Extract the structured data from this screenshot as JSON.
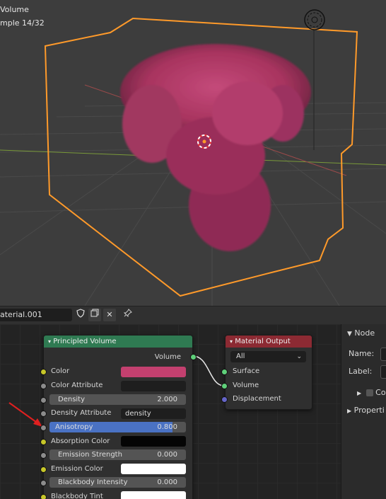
{
  "viewport": {
    "overlay_line1": " Volume",
    "overlay_line2": "mple 14/32"
  },
  "node_header": {
    "material_name": "aterial.001",
    "shield_icon": "shield-icon",
    "copy_icon": "copy-icon",
    "close_icon": "close-icon",
    "pin_icon": "pin-icon"
  },
  "principled_volume": {
    "title": "Principled Volume",
    "output_label": "Volume",
    "color_label": "Color",
    "color_value": "#c3406f",
    "color_attribute_label": "Color Attribute",
    "density_label": "Density",
    "density_value": "2.000",
    "density_attribute_label": "Density Attribute",
    "density_attribute_value": "density",
    "anisotropy_label": "Anisotropy",
    "anisotropy_value": "0.800",
    "anisotropy_fill": 0.9,
    "absorption_label": "Absorption Color",
    "emission_strength_label": "Emission Strength",
    "emission_strength_value": "0.000",
    "emission_color_label": "Emission Color",
    "blackbody_intensity_label": "Blackbody Intensity",
    "blackbody_intensity_value": "0.000",
    "blackbody_tint_label": "Blackbody Tint"
  },
  "material_output": {
    "title": "Material Output",
    "target_value": "All",
    "surface_label": "Surface",
    "volume_label": "Volume",
    "displacement_label": "Displacement"
  },
  "sidebar": {
    "node_panel": "Node",
    "name_label": "Name:",
    "label_label": "Label:",
    "color_checkbox_label": "Co",
    "properties_panel": "Properti"
  },
  "colors": {
    "accent_orange": "#ff9a2a",
    "volume_pink": "#a8345f",
    "principled_header": "#2f7a52",
    "output_header": "#8c2a33",
    "anisotropy_blue": "#4a72c4",
    "annotation_red": "#e02020"
  }
}
